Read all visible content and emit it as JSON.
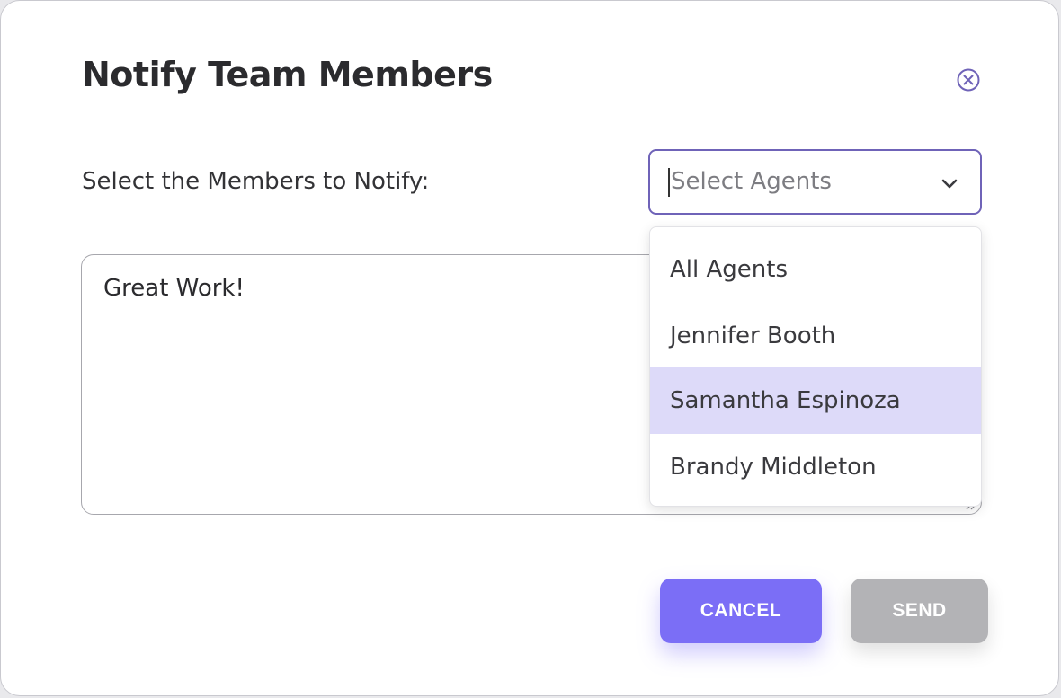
{
  "dialog": {
    "title": "Notify Team Members",
    "close_icon": "close-circle-icon"
  },
  "form": {
    "members_label": "Select the Members to Notify:",
    "select": {
      "placeholder": "Select Agents",
      "chevron_icon": "chevron-down-icon",
      "border_color": "#6f63b8"
    },
    "message": {
      "value": "Great Work!"
    }
  },
  "dropdown": {
    "options": [
      {
        "label": "All Agents"
      },
      {
        "label": "Jennifer Booth"
      },
      {
        "label": "Samantha Espinoza",
        "highlighted": true
      },
      {
        "label": "Brandy Middleton"
      }
    ],
    "highlight_color": "#dddaf9"
  },
  "actions": {
    "cancel_label": "CANCEL",
    "send_label": "SEND",
    "cancel_color": "#7b6ef6",
    "send_color": "#b3b3b6"
  }
}
